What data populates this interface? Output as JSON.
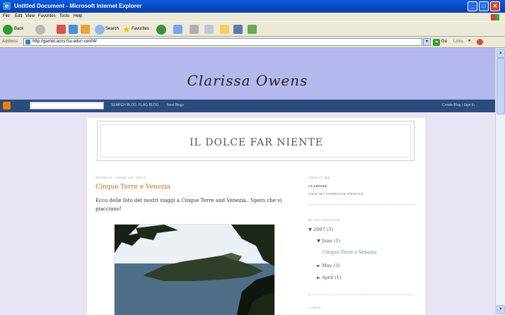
{
  "window": {
    "title": "Untitled Document - Microsoft Internet Explorer",
    "min_glyph": "_",
    "max_glyph": "□",
    "close_glyph": "✕"
  },
  "menu": [
    "File",
    "Edit",
    "View",
    "Favorites",
    "Tools",
    "Help"
  ],
  "toolbar": {
    "back_label": "Back",
    "search_label": "Search",
    "favorites_label": "Favorites"
  },
  "address": {
    "label": "Address",
    "url": "http://garnet.acns.fsu.edu/~ceo04/",
    "go_label": "Go",
    "links_label": "Links"
  },
  "blog": {
    "site_title": "Clarissa Owens",
    "navbar": {
      "search_this": "SEARCH BLOG",
      "flag": "FLAG BLOG",
      "next": "Next Blog»",
      "create": "Create Blog | Sign In"
    },
    "name": "IL DOLCE FAR NIENTE",
    "post": {
      "date": "SUNDAY, JUNE 10, 2007",
      "title": "Cinque Terre e Venezia",
      "body": "Ecco delle foto del nostri viaggi a Cinque Terre and Venezia.. Spero che vi piacciano!"
    },
    "sidebar": {
      "about_head": "ABOUT ME",
      "name": "CLARISSA",
      "profile_link": "VIEW MY COMPLETE PROFILE",
      "archive_head": "BLOG ARCHIVE",
      "archive": {
        "year": "▼ 2007 (5)",
        "month_open": "▼ June (1)",
        "post": "Cinque Terre e Venezia",
        "may": "► May (3)",
        "april": "► April (1)"
      },
      "links_head": "LINKS"
    }
  },
  "colors": {
    "header_band": "#b4b8ec",
    "page_bg": "#e9e4f3",
    "navbar": "#2c4c7e",
    "post_title": "#c66a1c"
  }
}
